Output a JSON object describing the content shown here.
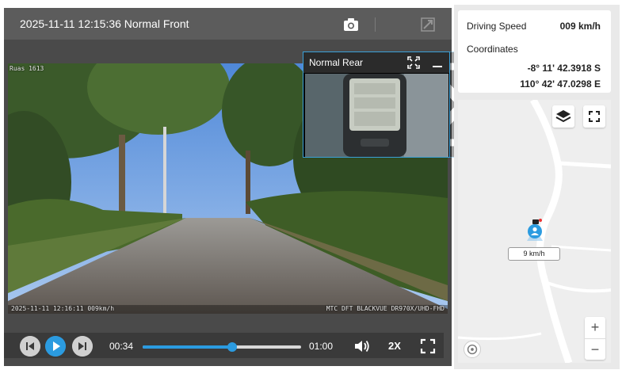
{
  "video": {
    "title": "2025-11-11 12:15:36 Normal Front",
    "osd_top_left": "Ruas 1613",
    "osd_bottom_left": "2025-11-11 12:16:11 009km/h",
    "osd_bottom_right": "MTC DFT BLACKVUE DR970X/UHD-FHD"
  },
  "pip": {
    "title": "Normal Rear"
  },
  "controls": {
    "current_time": "00:34",
    "duration": "01:00",
    "progress_fraction": 0.565,
    "speed_label": "2X"
  },
  "info": {
    "speed_label": "Driving Speed",
    "speed_value": "009 km/h",
    "coordinates_label": "Coordinates",
    "latitude": "-8° 11' 42.3918 S",
    "longitude": "110° 42' 47.0298 E"
  },
  "map": {
    "marker_label": "9 km/h",
    "zoom_in": "+",
    "zoom_out": "−"
  },
  "colors": {
    "accent": "#2b9be0",
    "panel_dark": "#4a4a4a",
    "header": "#5c5c5c"
  }
}
